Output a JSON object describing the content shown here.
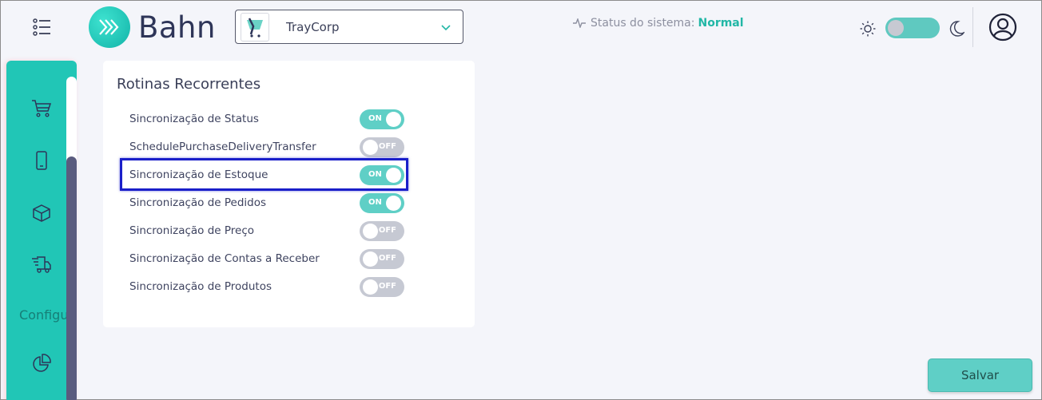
{
  "header": {
    "brand_name": "Bahn",
    "company_select": {
      "selected": "TrayCorp"
    },
    "status": {
      "label": "Status do sistema:",
      "value": "Normal",
      "value_color": "#22b7a6"
    },
    "accent_color": "#21c6b6"
  },
  "sidebar": {
    "items": [
      {
        "icon": "cart-icon"
      },
      {
        "icon": "mobile-icon"
      },
      {
        "icon": "box-icon"
      },
      {
        "icon": "truck-icon"
      },
      {
        "icon": "chart-pie-icon"
      }
    ],
    "partial_label": "Configu"
  },
  "routines": {
    "title": "Rotinas Recorrentes",
    "items": [
      {
        "label": "Sincronização de Status",
        "state": "ON"
      },
      {
        "label": "SchedulePurchaseDeliveryTransfer",
        "state": "OFF"
      },
      {
        "label": "Sincronização de Estoque",
        "state": "ON"
      },
      {
        "label": "Sincronização de Pedidos",
        "state": "ON"
      },
      {
        "label": "Sincronização de Preço",
        "state": "OFF"
      },
      {
        "label": "Sincronização de Contas a Receber",
        "state": "OFF"
      },
      {
        "label": "Sincronização de Produtos",
        "state": "OFF"
      }
    ]
  },
  "actions": {
    "save_label": "Salvar"
  }
}
